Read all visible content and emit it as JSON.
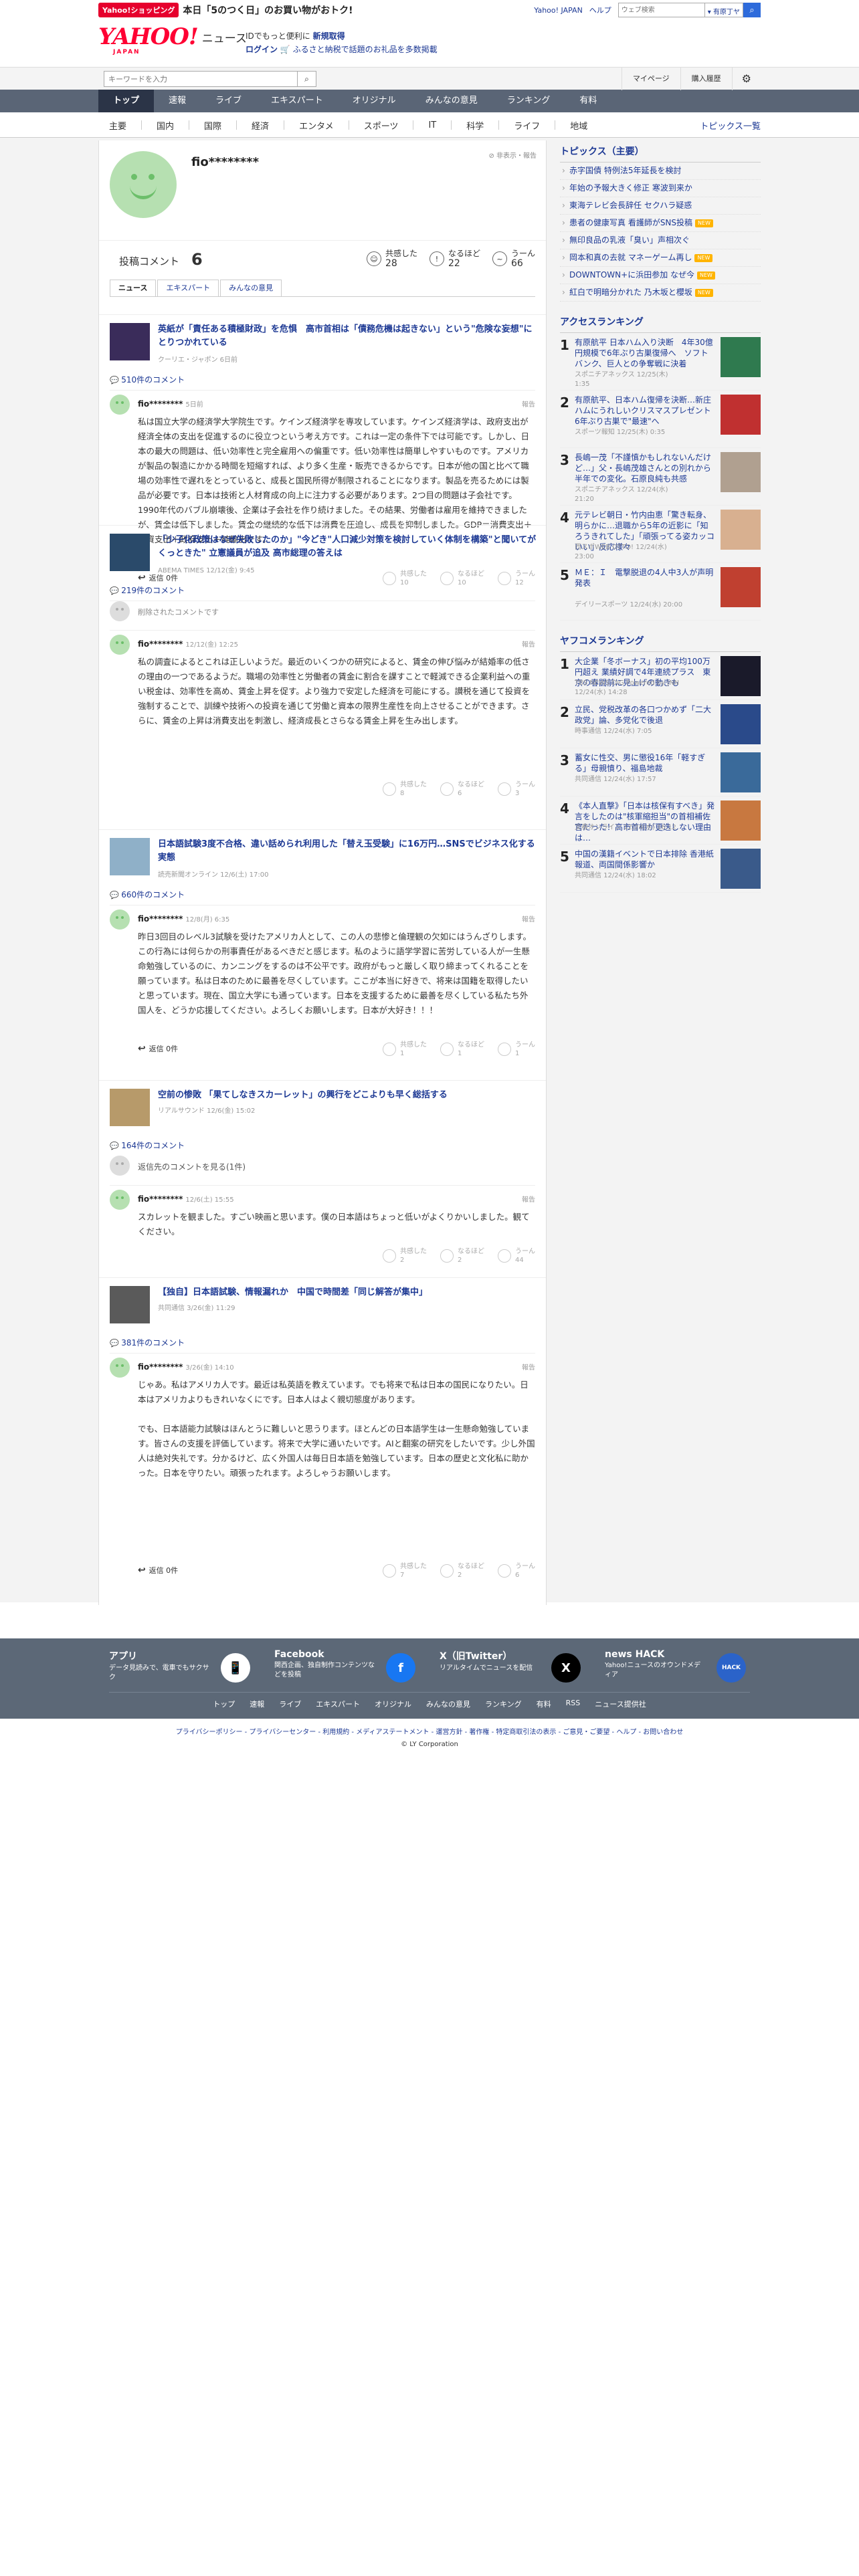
{
  "masthead": {
    "promo_badge": "Yahoo!ショッピング",
    "promo_text": "本日「5のつく日」のお買い物がおトク!",
    "links": [
      "Yahoo! JAPAN",
      "ヘルプ"
    ],
    "search_placeholder": "ウェブ検索",
    "search_scope": "▾ 有原丁ヤ",
    "logo": "YAHOO!",
    "logo_sub": "JAPAN",
    "logo_news": "ニュース",
    "info_line1_prefix": "IDでもっと便利に",
    "info_line1_link": "新規取得",
    "info_line2_link": "ログイン",
    "info_line2_rest": "🛒 ふるさと納税で話題のお礼品を多数掲載"
  },
  "subbar": {
    "search_placeholder": "キーワードを入力",
    "mypage": "マイページ",
    "history": "購入履歴"
  },
  "nav_primary": [
    "トップ",
    "速報",
    "ライブ",
    "エキスパート",
    "オリジナル",
    "みんなの意見",
    "ランキング",
    "有料"
  ],
  "nav_secondary": [
    "主要",
    "国内",
    "国際",
    "経済",
    "エンタメ",
    "スポーツ",
    "IT",
    "科学",
    "ライフ",
    "地域"
  ],
  "nav_topics": "トピックス一覧",
  "profile": {
    "name": "fio********",
    "report_label": "非表示・報告",
    "comments_label": "投稿コメント",
    "comments_count": "6",
    "reactions": [
      {
        "icon": "☺",
        "label": "共感した",
        "count": "28"
      },
      {
        "icon": "!",
        "label": "なるほど",
        "count": "22"
      },
      {
        "icon": "~",
        "label": "うーん",
        "count": "66"
      }
    ],
    "tabs": [
      "ニュース",
      "エキスパート",
      "みんなの意見"
    ]
  },
  "articles": [
    {
      "title": "英紙が「責任ある積極財政」を危惧　高市首相は「債務危機は起きない」という\"危険な妄想\"にとりつかれている",
      "source": "クーリエ・ジャポン 6日前",
      "comment_count": "510件のコメント",
      "comments": [
        {
          "name": "fio********",
          "date": "5日前",
          "report": "報告",
          "body": "私は国立大学の経済学大学院生です。ケインズ経済学を専攻しています。ケインズ経済学は、政府支出が経済全体の支出を促進するのに役立つという考え方です。これは一定の条件下では可能です。しかし、日本の最大の問題は、低い効率性と完全雇用への偏重です。低い効率性は簡単しやすいものです。アメリカが製品の製造にかかる時間を短縮すれば、より多く生産・販売できるからです。日本が他の国と比べて職場の効率性で遅れをとっていると、成長と国民所得が制限されることになります。製品を売るためには製品が必要です。日本は技術と人材育成の向上に注力する必要があります。2つ目の問題は子会社です。1990年代のバブル崩壊後、企業は子会社を作り続けました。その結果、労働者は雇用を維持できましたが、賃金は低下しました。賃金の継続的な低下は消費を圧迫し、成長を抑制しました。GDP＝消費支出＋投資支出＋政府支出＋純輸出です。",
          "reply": "返信 0件",
          "reacts": [
            [
              "共感した",
              "10"
            ],
            [
              "なるほど",
              "10"
            ],
            [
              "うーん",
              "12"
            ]
          ]
        }
      ]
    },
    {
      "title": "「少子化政策はなぜ失敗したのか」\"今どき\"人口減少対策を検討していく体制を構築\"と聞いてがくっときた\" 立憲議員が追及 高市総理の答えは",
      "source": "ABEMA TIMES 12/12(金) 9:45",
      "comment_count": "219件のコメント",
      "deleted_text": "削除されたコメントです",
      "comments": [
        {
          "name": "fio********",
          "date": "12/12(金) 12:25",
          "report": "報告",
          "body": "私の調査によるとこれは正しいようだ。最近のいくつかの研究によると、賃金の伸び悩みが結婚率の低さの理由の一つであるようだ。職場の効率性と労働者の賃金に割合を課すことで軽減できる企業利益への重い税金は、効率性を高め、賃金上昇を促す。より強力で安定した経済を可能にする。讃税を通じて投資を強制することで、訓練や技術への投資を通じて労働と資本の限界生産性を向上させることができます。さらに、賃金の上昇は消費支出を刺激し、経済成長とさらなる賃金上昇を生み出します。",
          "reply": "",
          "reacts": [
            [
              "共感した",
              "8"
            ],
            [
              "なるほど",
              "6"
            ],
            [
              "うーん",
              "3"
            ]
          ]
        }
      ]
    },
    {
      "title": "日本語試験3度不合格、違い話められ利用した「替え玉受験」に16万円…SNSでビジネス化する実態",
      "source": "読売新聞オンライン 12/6(土) 17:00",
      "comment_count": "660件のコメント",
      "comments": [
        {
          "name": "fio********",
          "date": "12/8(月) 6:35",
          "report": "報告",
          "body": "昨日3回目のレベル3試験を受けたアメリカ人として、この人の悲惨と倫理観の欠如にはうんざりします。この行為には何らかの刑事責任があるべきだと感じます。私のように語学学習に苦労している人が一生懸命勉強しているのに、カンニングをするのは不公平です。政府がもっと厳しく取り締まってくれることを願っています。私は日本のために最善を尽くしています。ここが本当に好きで、将来は国籍を取得したいと思っています。現在、国立大学にも通っています。日本を支援するために最善を尽くしている私たち外国人を、どうか応援してください。よろしくお願いします。日本が大好き！！！",
          "reply": "返信 0件",
          "reacts": [
            [
              "共感した",
              "1"
            ],
            [
              "なるほど",
              "1"
            ],
            [
              "うーん",
              "1"
            ]
          ]
        }
      ]
    },
    {
      "title": "空前の惨敗 「果てしなきスカーレット」の興行をどこよりも早く総括する",
      "source": "リアルサウンド 12/6(金) 15:02",
      "comment_count": "164件のコメント",
      "more_replies": "返信先のコメントを見る(1件)",
      "comments": [
        {
          "name": "fio********",
          "date": "12/6(土) 15:55",
          "report": "報告",
          "body": "スカレットを観ました。すごい映画と思います。僕の日本語はちょっと低いがよくりかいしました。観てください。",
          "reply": "",
          "reacts": [
            [
              "共感した",
              "2"
            ],
            [
              "なるほど",
              "2"
            ],
            [
              "うーん",
              "44"
            ]
          ]
        }
      ]
    },
    {
      "title": "【独自】日本語試験、情報漏れか　中国で時間差「同じ解答が集中」",
      "source": "共同通信 3/26(金) 11:29",
      "comment_count": "381件のコメント",
      "comments": [
        {
          "name": "fio********",
          "date": "3/26(金) 14:10",
          "report": "報告",
          "body": "じゃあ。私はアメリカ人です。最近は私英語を教えています。でも将来で私は日本の国民になりたい。日本はアメリカよりもきれいなくにです。日本人はよく親切態度があります。\n\nでも、日本語能力試験はほんとうに難しいと思うります。ほとんどの日本語学生は一生懸命勉強しています。皆さんの支援を評価しています。将来で大学に通いたいです。AIと翻案の研究をしたいです。少し外国人は絶対失礼です。分かるけど、広く外国人は毎日日本語を勉強しています。日本の歴史と文化私に助かった。日本を守りたい。頑張ったれます。よろしゃうお願いします。",
          "reply": "返信 0件",
          "reacts": [
            [
              "共感した",
              "7"
            ],
            [
              "なるほど",
              "2"
            ],
            [
              "うーん",
              "6"
            ]
          ]
        }
      ]
    }
  ],
  "sidebar": {
    "topics_title": "トピックス（主要）",
    "topics": [
      {
        "text": "赤字国債 特例法5年延長を検討",
        "badge": ""
      },
      {
        "text": "年始の予報大きく修正 寒波到来か",
        "badge": ""
      },
      {
        "text": "東海テレビ会長辞任 セクハラ疑惑",
        "badge": ""
      },
      {
        "text": "患者の健康写真 看護師がSNS投稿",
        "badge": "NEW"
      },
      {
        "text": "無印良品の乳液「臭い」声相次ぐ",
        "badge": ""
      },
      {
        "text": "岡本和真の去就 マネーゲーム再し",
        "badge": "NEW"
      },
      {
        "text": "DOWNTOWN+に浜田参加 なぜ今",
        "badge": "NEW"
      },
      {
        "text": "紅白で明暗分かれた 乃木坂と櫻坂",
        "badge": "NEW"
      }
    ],
    "access_title": "アクセスランキング",
    "access": [
      {
        "num": "1",
        "title": "有原航平 日本ハム入り決断　4年30億円規模で6年ぶり古巣復帰へ　ソフトバンク、巨人との争奪戦に決着",
        "src": "スポニチアネックス 12/25(木)",
        "time": "1:35"
      },
      {
        "num": "2",
        "title": "有原航平、日本ハム復帰を決断…新庄ハムにうれしいクリスマスプレゼント　6年ぶり古巣で\"最速\"へ",
        "src": "スポーツ報知 12/25(木) 0:35",
        "time": ""
      },
      {
        "num": "3",
        "title": "長嶋一茂「不謹慎かもしれないんだけど…」父・長嶋茂雄さんとの別れから半年での変化。石原良純も共感",
        "src": "スポニチアネックス 12/24(水)",
        "time": "21:20"
      },
      {
        "num": "4",
        "title": "元テレビ朝日・竹内由恵「驚き転身、明らかに…退職から5年の近影に「知ろうきれてした」「頑張ってる姿カッコいい」反応様々",
        "src": "西スポWEB OTTO! 12/24(水)",
        "time": "23:00"
      },
      {
        "num": "5",
        "title": "ＭＥ：Ｉ　電撃脱退の4人中3人が声明発表",
        "src": "デイリースポーツ 12/24(水) 20:00",
        "time": ""
      }
    ],
    "yafoo_title": "ヤフコメランキング",
    "yafoo": [
      {
        "num": "1",
        "title": "大企業「冬ボーナス」初の平均100万円超え 業績好調で4年連続プラス　東京の春闘前に見上げの動きも",
        "src": "TBS NEWS DIG Powered by JNN",
        "time": "12/24(水) 14:28"
      },
      {
        "num": "2",
        "title": "立民、党税改革の各口つかめず「二大政党」論、多党化で後退",
        "src": "時事通信 12/24(水) 7:05",
        "time": ""
      },
      {
        "num": "3",
        "title": "蓄女に性交、男に懲役16年「軽すぎる」母親憤り、福島地裁",
        "src": "共同通信 12/24(水) 17:57",
        "time": ""
      },
      {
        "num": "4",
        "title": "《本人直撃》「日本は核保有すべき」発言をしたのは\"核軍縮担当\"の首相補佐官だった！高市首相が更迭しない理由は…",
        "src": "文春オンライン 12/24(水) 16:12",
        "time": ""
      },
      {
        "num": "5",
        "title": "中国の漢籍イベントで日本排除 香港紙報道、両国間係影響か",
        "src": "共同通信 12/24(水) 18:02",
        "time": ""
      }
    ]
  },
  "footer": {
    "cols": [
      {
        "title": "アプリ",
        "desc": "データ見読みで、電車でもサクサク",
        "icon": "📱"
      },
      {
        "title": "Facebook",
        "desc": "関西企画、独自制作コンテンツなどを投稿",
        "icon": "f"
      },
      {
        "title": "X（旧Twitter）",
        "desc": "リアルタイムでニュースを配信",
        "icon": "X"
      },
      {
        "title": "news HACK",
        "desc": "Yahoo!ニュースのオウンドメディア",
        "icon": "HACK"
      }
    ],
    "links": [
      "トップ",
      "速報",
      "ライブ",
      "エキスパート",
      "オリジナル",
      "みんなの意見",
      "ランキング",
      "有料",
      "RSS",
      "ニュース提供社"
    ],
    "legal": "プライバシーポリシー - プライバシーセンター - 利用規約 - メディアステートメント - 運営方針 - 著作権 - 特定商取引法の表示 - ご意見・ご要望 - ヘルプ - お問い合わせ",
    "copyright": "© LY Corporation"
  },
  "colors": {
    "brand_red": "#ff0033",
    "link_blue": "#1d3994",
    "nav_dark": "#5a6576",
    "nav_active": "#2b3447",
    "footer": "#5c6877"
  }
}
